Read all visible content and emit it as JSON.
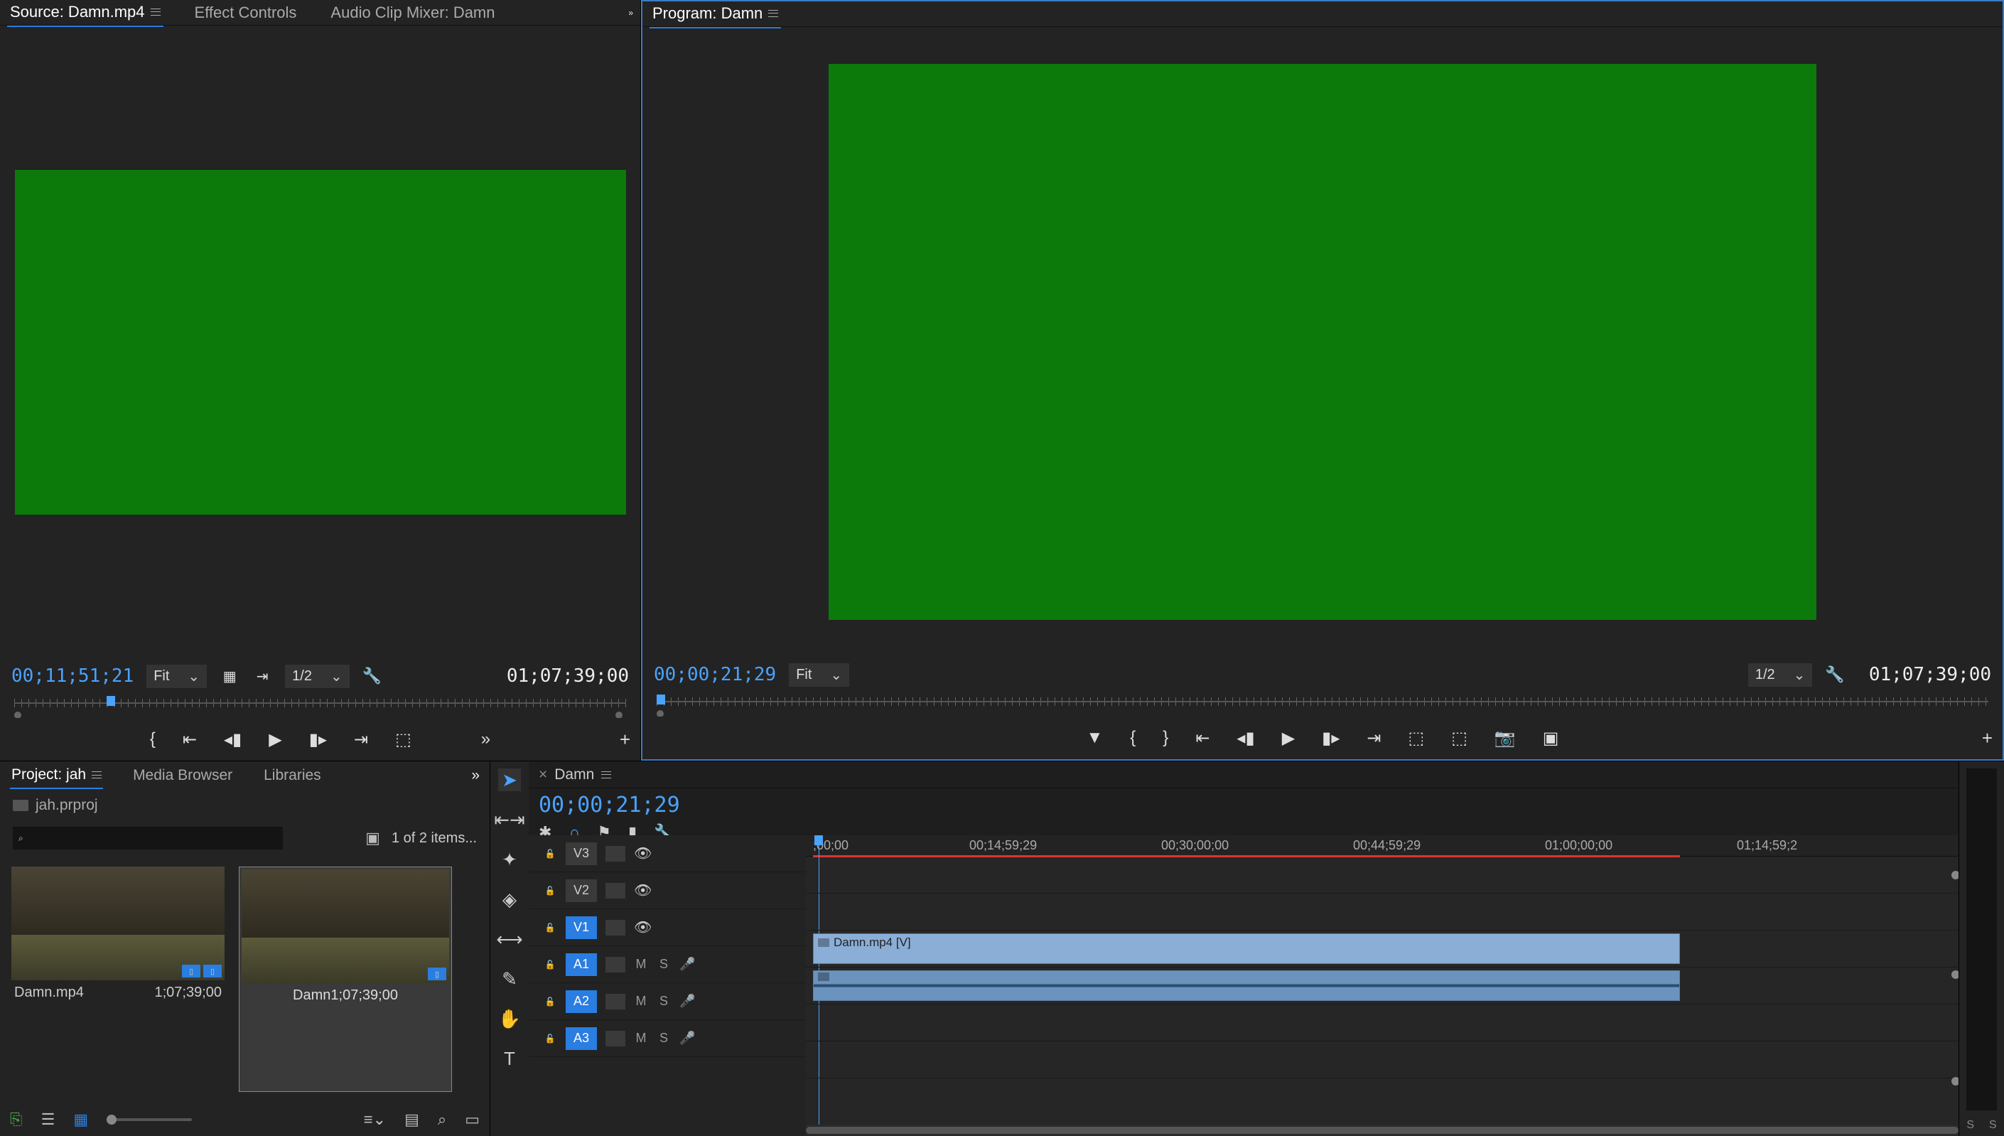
{
  "source": {
    "tabs": [
      "Source: Damn.mp4",
      "Effect Controls",
      "Audio Clip Mixer: Damn"
    ],
    "tc_left": "00;11;51;21",
    "tc_right": "01;07;39;00",
    "zoom_sel": "Fit",
    "res_sel": "1/2"
  },
  "program": {
    "title": "Program: Damn",
    "tc_left": "00;00;21;29",
    "tc_right": "01;07;39;00",
    "zoom_sel": "Fit",
    "res_sel": "1/2"
  },
  "project": {
    "tabs": [
      "Project: jah",
      "Media Browser",
      "Libraries"
    ],
    "file": "jah.prproj",
    "status": "1 of 2 items...",
    "search_placeholder": "",
    "items": [
      {
        "name": "Damn.mp4",
        "dur": "1;07;39;00",
        "selected": false
      },
      {
        "name": "Damn",
        "dur": "1;07;39;00",
        "selected": true
      }
    ]
  },
  "timeline": {
    "tab": "Damn",
    "tc": "00;00;21;29",
    "ruler": [
      ";00;00",
      "00;14;59;29",
      "00;30;00;00",
      "00;44;59;29",
      "01;00;00;00",
      "01;14;59;2"
    ],
    "tracks": {
      "video": [
        "V3",
        "V2",
        "V1"
      ],
      "audio": [
        "A1",
        "A2",
        "A3"
      ]
    },
    "clip_name": "Damn.mp4 [V]",
    "tools": [
      "selection",
      "track-select",
      "ripple",
      "rate-stretch",
      "razor",
      "slip",
      "pen",
      "hand",
      "type"
    ],
    "meter_labels": [
      "S",
      "S"
    ]
  },
  "colors": {
    "accent": "#2a7de1",
    "green": "#0b7a0b"
  }
}
